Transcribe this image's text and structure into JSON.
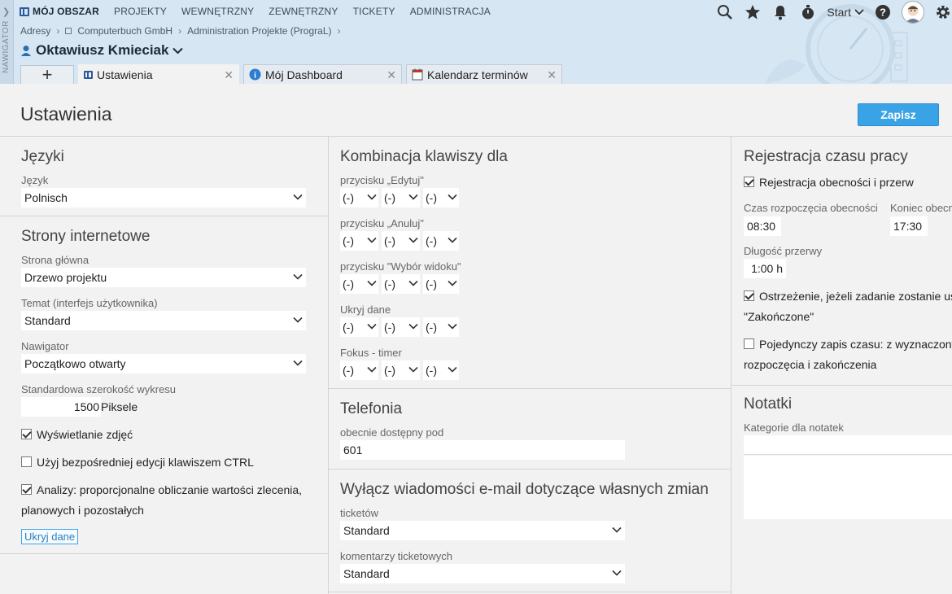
{
  "nav": {
    "label": "NAWIGATOR"
  },
  "topmenu": [
    "MÓJ OBSZAR",
    "PROJEKTY",
    "WEWNĘTRZNY",
    "ZEWNĘTRZNY",
    "TICKETY",
    "ADMINISTRACJA"
  ],
  "tools": {
    "start_label": "Start"
  },
  "breadcrumb": [
    "Adresy",
    "Computerbuch GmbH",
    "Administration Projekte (PrograL)"
  ],
  "user_name": "Oktawiusz Kmieciak",
  "tabs": [
    {
      "label": "Ustawienia"
    },
    {
      "label": "Mój Dashboard"
    },
    {
      "label": "Kalendarz terminów"
    }
  ],
  "page_title": "Ustawienia",
  "save_label": "Zapisz",
  "languages": {
    "title": "Języki",
    "language_label": "Język",
    "language_value": "Polnisch"
  },
  "web": {
    "title": "Strony internetowe",
    "homepage_label": "Strona główna",
    "homepage_value": "Drzewo projektu",
    "theme_label": "Temat (interfejs użytkownika)",
    "theme_value": "Standard",
    "navigator_label": "Nawigator",
    "navigator_value": "Początkowo otwarty",
    "chart_width_label": "Standardowa szerokość wykresu",
    "chart_width_value": "1500",
    "chart_width_unit": "Piksele",
    "show_photos": "Wyświetlanie zdjęć",
    "ctrl_edit": "Użyj bezpośredniej edycji klawiszem CTRL",
    "analysis_line1": "Analizy: proporcjonalne obliczanie wartości zlecenia,",
    "analysis_line2": "planowych i pozostałych",
    "hide_data": "Ukryj dane"
  },
  "shortcuts": {
    "title": "Kombinacja klawiszy dla",
    "rows": [
      {
        "label": "przycisku „Edytuj\"",
        "values": [
          "(-)",
          "(-)",
          "(-)"
        ]
      },
      {
        "label": "przycisku „Anuluj\"",
        "values": [
          "(-)",
          "(-)",
          "(-)"
        ]
      },
      {
        "label": "przycisku \"Wybór widoku\"",
        "values": [
          "(-)",
          "(-)",
          "(-)"
        ]
      },
      {
        "label": "Ukryj dane",
        "values": [
          "(-)",
          "(-)",
          "(-)"
        ]
      },
      {
        "label": "Fokus - timer",
        "values": [
          "(-)",
          "(-)",
          "(-)"
        ]
      }
    ]
  },
  "phone": {
    "title": "Telefonia",
    "label": "obecnie dostępny pod",
    "value": "601"
  },
  "email": {
    "title": "Wyłącz wiadomości e-mail dotyczące własnych zmian",
    "tickets_label": "ticketów",
    "tickets_value": "Standard",
    "comments_label": "komentarzy ticketowych",
    "comments_value": "Standard"
  },
  "time": {
    "title": "Rejestracja czasu pracy",
    "attendance": "Rejestracja obecności i przerw",
    "start_label": "Czas rozpoczęcia obecności",
    "start_value": "08:30",
    "end_label": "Koniec obecn",
    "end_value": "17:30",
    "break_label": "Długość przerwy",
    "break_value": "1:00 h",
    "warning_line1": "Ostrzeżenie, jeżeli zadanie zostanie us",
    "warning_line2": "\"Zakończone\"",
    "single_line1": "Pojedynczy zapis czasu: z wyznaczony",
    "single_line2": "rozpoczęcia i zakończenia"
  },
  "notes": {
    "title": "Notatki",
    "category_label": "Kategorie dla notatek"
  }
}
